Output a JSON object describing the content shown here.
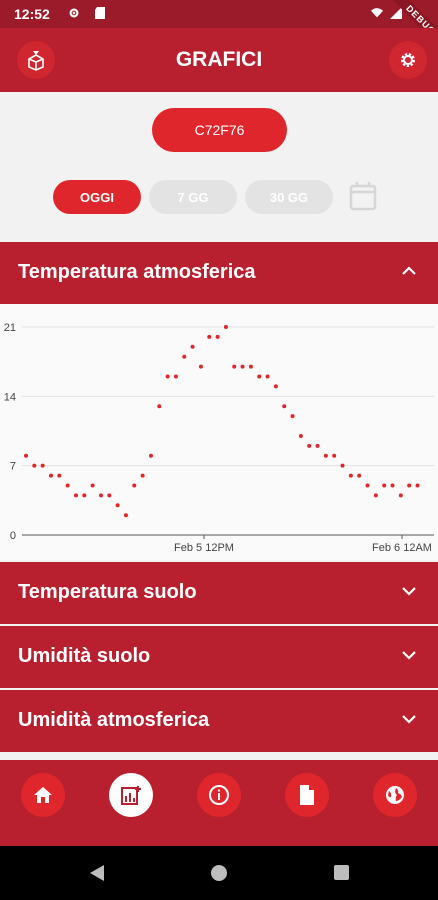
{
  "status_bar": {
    "time": "12:52",
    "debug_label": "DEBUG"
  },
  "app_bar": {
    "title": "GRAFICI",
    "logo_icon": "box-logo-icon",
    "settings_icon": "gear-icon"
  },
  "device": {
    "id": "C72F76"
  },
  "periods": [
    {
      "label": "OGGI",
      "active": true
    },
    {
      "label": "7 GG",
      "active": false
    },
    {
      "label": "30 GG",
      "active": false
    }
  ],
  "sections": [
    {
      "label": "Temperatura atmosferica",
      "expanded": true
    },
    {
      "label": "Temperatura suolo",
      "expanded": false
    },
    {
      "label": "Umidità suolo",
      "expanded": false
    },
    {
      "label": "Umidità atmosferica",
      "expanded": false
    }
  ],
  "chart_data": {
    "type": "scatter",
    "title": "",
    "xlabel": "",
    "ylabel": "",
    "ylim": [
      0,
      21
    ],
    "y_ticks": [
      "0",
      "7",
      "14",
      "21"
    ],
    "x_tick_labels": [
      "Feb 5 12PM",
      "Feb 6 12AM"
    ],
    "grid": true,
    "series_color": "#e0262d",
    "x": [
      "Feb 5 00:00",
      "Feb 5 00:30",
      "Feb 5 01:00",
      "Feb 5 01:30",
      "Feb 5 02:00",
      "Feb 5 02:30",
      "Feb 5 03:00",
      "Feb 5 03:30",
      "Feb 5 04:00",
      "Feb 5 04:30",
      "Feb 5 05:00",
      "Feb 5 05:30",
      "Feb 5 06:00",
      "Feb 5 06:30",
      "Feb 5 07:00",
      "Feb 5 07:30",
      "Feb 5 08:00",
      "Feb 5 08:30",
      "Feb 5 09:00",
      "Feb 5 09:30",
      "Feb 5 10:00",
      "Feb 5 10:30",
      "Feb 5 11:00",
      "Feb 5 11:30",
      "Feb 5 12:00",
      "Feb 5 12:30",
      "Feb 5 13:00",
      "Feb 5 13:30",
      "Feb 5 14:00",
      "Feb 5 14:30",
      "Feb 5 15:00",
      "Feb 5 15:30",
      "Feb 5 16:00",
      "Feb 5 16:30",
      "Feb 5 17:00",
      "Feb 5 17:30",
      "Feb 5 18:00",
      "Feb 5 18:30",
      "Feb 5 19:00",
      "Feb 5 19:30",
      "Feb 5 20:00",
      "Feb 5 20:30",
      "Feb 5 21:00",
      "Feb 5 21:30",
      "Feb 5 22:00",
      "Feb 5 22:30",
      "Feb 5 23:00",
      "Feb 5 23:30"
    ],
    "values": [
      8,
      7,
      7,
      6,
      6,
      5,
      4,
      4,
      5,
      4,
      4,
      3,
      2,
      5,
      6,
      8,
      13,
      16,
      16,
      18,
      19,
      17,
      20,
      20,
      21,
      17,
      17,
      17,
      16,
      16,
      15,
      13,
      12,
      10,
      9,
      9,
      8,
      8,
      7,
      6,
      6,
      5,
      4,
      5,
      5,
      4,
      5,
      5
    ]
  },
  "bottom_nav": [
    {
      "icon": "home-icon",
      "active": false
    },
    {
      "icon": "chart-icon",
      "active": true
    },
    {
      "icon": "info-icon",
      "active": false
    },
    {
      "icon": "document-icon",
      "active": false
    },
    {
      "icon": "globe-icon",
      "active": false
    }
  ],
  "system_nav": [
    "back-icon",
    "home-circle-icon",
    "recents-icon"
  ]
}
